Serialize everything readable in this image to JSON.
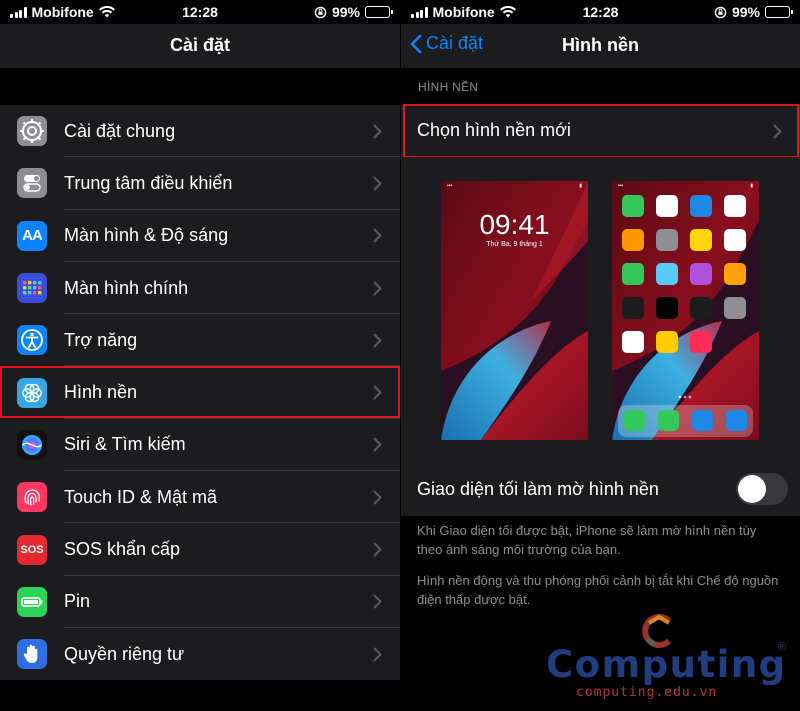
{
  "status_bar": {
    "carrier": "Mobifone",
    "time": "12:28",
    "battery": "99%"
  },
  "left": {
    "nav_title": "Cài đặt",
    "items": [
      {
        "label": "Cài đặt chung",
        "icon": "gear-icon",
        "color": "#8e8e93"
      },
      {
        "label": "Trung tâm điều khiển",
        "icon": "toggles-icon",
        "color": "#8e8e93"
      },
      {
        "label": "Màn hình & Độ sáng",
        "icon": "text-size-icon",
        "color": "#0a84ff"
      },
      {
        "label": "Màn hình chính",
        "icon": "home-grid-icon",
        "color": "#3a4ed8"
      },
      {
        "label": "Trợ năng",
        "icon": "accessibility-icon",
        "color": "#0a84ff"
      },
      {
        "label": "Hình nền",
        "icon": "flower-icon",
        "color": "#36a6e6"
      },
      {
        "label": "Siri & Tìm kiếm",
        "icon": "siri-icon",
        "color": "#111111"
      },
      {
        "label": "Touch ID & Mật mã",
        "icon": "fingerprint-icon",
        "color": "#ff375f"
      },
      {
        "label": "SOS khẩn cấp",
        "icon": "sos-icon",
        "color": "#e5292f"
      },
      {
        "label": "Pin",
        "icon": "battery-icon",
        "color": "#30d158"
      },
      {
        "label": "Quyền riêng tư",
        "icon": "hand-icon",
        "color": "#2f6fe4"
      }
    ],
    "icon_texts": {
      "display": "AA",
      "sos": "SOS"
    },
    "highlight_index": 5
  },
  "right": {
    "back_label": "Cài đặt",
    "nav_title": "Hình nền",
    "section_header": "HÌNH NỀN",
    "choose_label": "Chọn hình nền mới",
    "lock_preview": {
      "time": "09:41",
      "date": "Thứ Ba, 9 tháng 1"
    },
    "toggle_label": "Giao diện tối làm mờ hình nền",
    "toggle_on": false,
    "footnote_1": "Khi Giao diện tối được bật, iPhone sẽ làm mờ hình nền tùy theo ánh sáng môi trường của bạn.",
    "footnote_2": "Hình nền động và thu phóng phối cảnh bị tắt khi Chế độ nguồn điện thấp được bật."
  },
  "watermark": {
    "word": "Computing",
    "registered": "®",
    "url": "computing.edu.vn"
  },
  "colors": {
    "highlight": "#e0141e",
    "ios_blue": "#0a84ff",
    "cell_bg": "#1c1c1e"
  }
}
